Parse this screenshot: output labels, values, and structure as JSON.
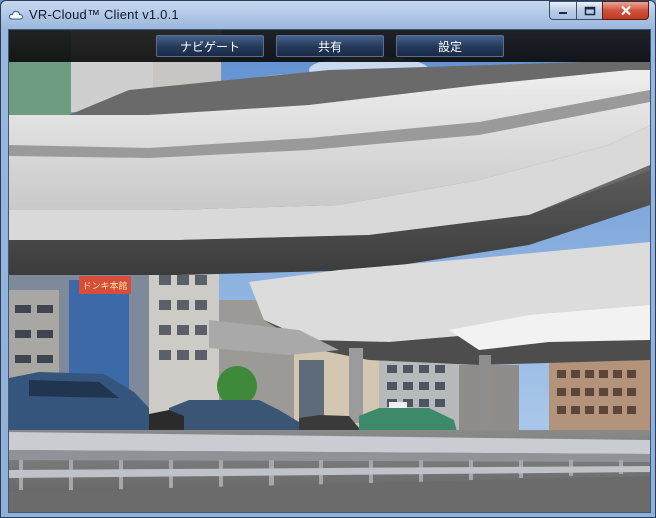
{
  "window": {
    "title": "VR-Cloud™ Client v1.0.1",
    "icon": "cloud-icon"
  },
  "toolbar": {
    "navigate_label": "ナビゲート",
    "share_label": "共有",
    "settings_label": "設定"
  },
  "viewport": {
    "billboard_text": "ドンキ本館"
  },
  "colors": {
    "titlebar": "#9bb7dc",
    "close_button": "#c94a33",
    "toolbar_bg": "#111111",
    "toolbar_button": "#2a3f63",
    "sky": "#7aa3d8"
  }
}
